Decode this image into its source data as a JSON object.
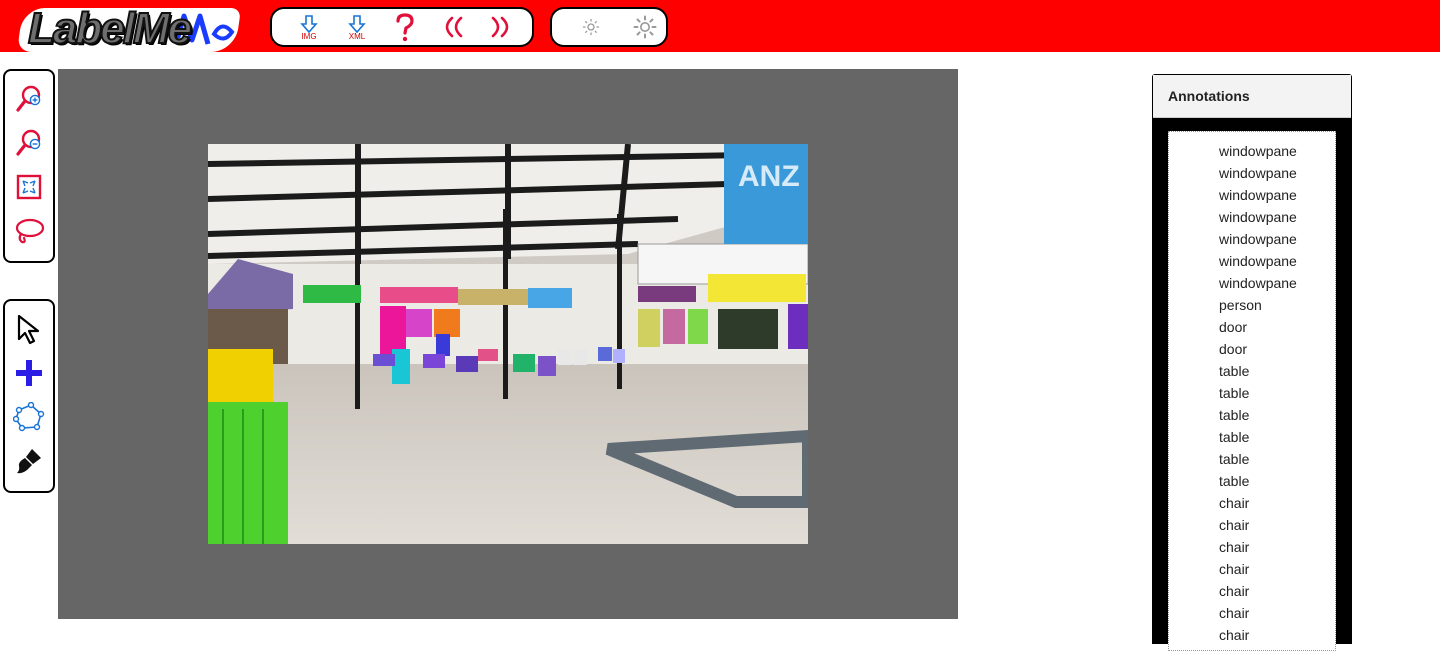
{
  "app": {
    "logo_text": "LabelMe"
  },
  "toolbar": {
    "buttons": [
      {
        "name": "download-image-button",
        "icon": "download-arrow-icon",
        "caption": "IMG"
      },
      {
        "name": "download-xml-button",
        "icon": "download-arrow-icon",
        "caption": "XML"
      },
      {
        "name": "help-button",
        "icon": "question-icon",
        "caption": ""
      },
      {
        "name": "previous-image-button",
        "icon": "double-chevron-left-icon",
        "caption": ""
      },
      {
        "name": "next-image-button",
        "icon": "double-chevron-right-icon",
        "caption": ""
      }
    ],
    "brightness": [
      {
        "name": "decrease-brightness-button",
        "icon": "brightness-low-icon"
      },
      {
        "name": "increase-brightness-button",
        "icon": "brightness-high-icon"
      }
    ]
  },
  "left_tools": {
    "group1": [
      "zoom-in-icon",
      "zoom-out-icon",
      "fit-to-screen-icon",
      "lasso-icon"
    ],
    "group2": [
      "select-arrow-icon",
      "add-point-icon",
      "polygon-icon",
      "brush-icon"
    ]
  },
  "annotations": {
    "title": "Annotations",
    "items": [
      "windowpane",
      "windowpane",
      "windowpane",
      "windowpane",
      "windowpane",
      "windowpane",
      "windowpane",
      "person",
      "door",
      "door",
      "table",
      "table",
      "table",
      "table",
      "table",
      "table",
      "chair",
      "chair",
      "chair",
      "chair",
      "chair",
      "chair",
      "chair"
    ]
  },
  "colors": {
    "topbar": "#ff0000",
    "canvas_background": "#666666",
    "icon_red": "#e0103a",
    "icon_blue": "#1a73d6"
  }
}
